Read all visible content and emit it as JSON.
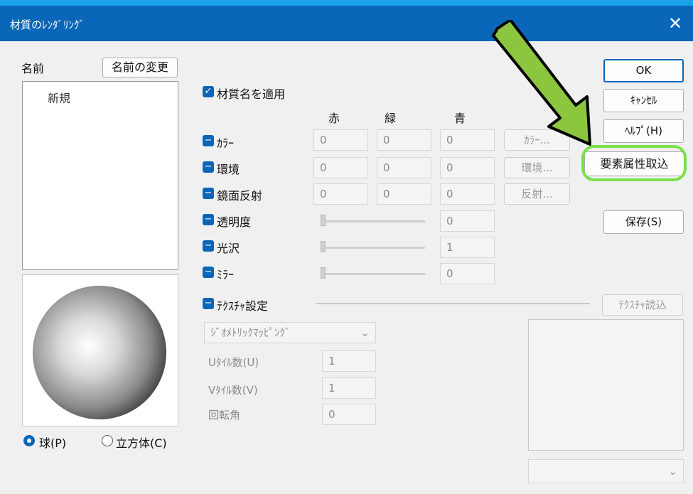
{
  "window": {
    "title": "材質のﾚﾝﾀﾞﾘﾝｸﾞ",
    "close_glyph": "✕"
  },
  "name_section": {
    "label": "名前",
    "rename_button": "名前の変更",
    "list_items": [
      "新規"
    ]
  },
  "apply_material_name": {
    "label": "材質名を適用",
    "checked": true
  },
  "color_headers": {
    "red": "赤",
    "green": "緑",
    "blue": "青"
  },
  "rows": [
    {
      "label": "ｶﾗｰ",
      "r": "0",
      "g": "0",
      "b": "0",
      "button": "ｶﾗｰ..."
    },
    {
      "label": "環境",
      "r": "0",
      "g": "0",
      "b": "0",
      "button": "環境..."
    },
    {
      "label": "鏡面反射",
      "r": "0",
      "g": "0",
      "b": "0",
      "button": "反射..."
    }
  ],
  "sliders": [
    {
      "label": "透明度",
      "value": "0",
      "level": 0
    },
    {
      "label": "光沢",
      "value": "1",
      "level": 0
    },
    {
      "label": "ﾐﾗｰ",
      "value": "0",
      "level": 0
    }
  ],
  "texture": {
    "label": "ﾃｸｽﾁｬ設定",
    "load_button": "ﾃｸｽﾁｬ読込",
    "mapping_value": "ｼﾞｵﾒﾄﾘｯｸﾏｯﾋﾟﾝｸﾞ",
    "u_tile_label": "Uﾀｲﾙ数(U)",
    "u_tile_value": "1",
    "v_tile_label": "Vﾀｲﾙ数(V)",
    "v_tile_value": "1",
    "rotation_label": "回転角",
    "rotation_value": "0"
  },
  "buttons": {
    "ok": "OK",
    "cancel": "ｷｬﾝｾﾙ",
    "help": "ﾍﾙﾌﾟ(H)",
    "import_attr": "要素属性取込",
    "save": "保存(S)"
  },
  "preview": {
    "sphere_option": "球(P)",
    "cube_option": "立方体(C)",
    "selected": "sphere"
  },
  "colors": {
    "accent": "#0a66b8",
    "annotation_arrow": "#8cc63f",
    "annotation_outline": "#79e04b",
    "frame": "#1aa3e8"
  }
}
